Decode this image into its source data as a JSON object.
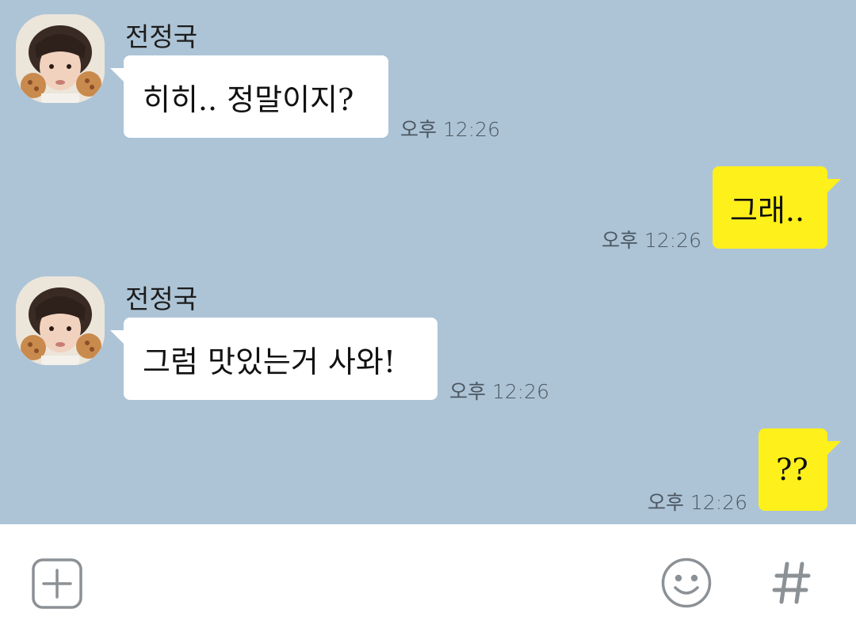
{
  "messages": [
    {
      "direction": "incoming",
      "sender": "전정국",
      "text": "히히.. 정말이지?",
      "time": "오후 12:26"
    },
    {
      "direction": "outgoing",
      "text": "그래..",
      "time": "오후 12:26"
    },
    {
      "direction": "incoming",
      "sender": "전정국",
      "text": "그럼 맛있는거 사와!",
      "time": "오후 12:26"
    },
    {
      "direction": "outgoing",
      "text": "??",
      "time": "오후 12:26"
    }
  ],
  "input_bar": {
    "icons": [
      "plus-icon",
      "emoji-icon",
      "hashtag-icon"
    ]
  },
  "colors": {
    "chat_background": "#adc4d6",
    "incoming_bubble": "#ffffff",
    "outgoing_bubble": "#fef01b",
    "icon_gray": "#8c9196"
  }
}
